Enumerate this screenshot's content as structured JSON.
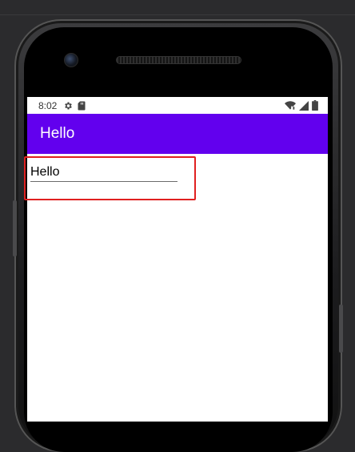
{
  "status_bar": {
    "time": "8:02",
    "icons": [
      "settings-gear-icon",
      "sd-card-icon",
      "wifi-icon",
      "cell-signal-icon",
      "battery-icon"
    ]
  },
  "app_bar": {
    "title": "Hello",
    "color": "#6200ee"
  },
  "main": {
    "edit_text": {
      "value": "Hello"
    }
  },
  "annotation": {
    "highlight_color": "#e02020"
  }
}
